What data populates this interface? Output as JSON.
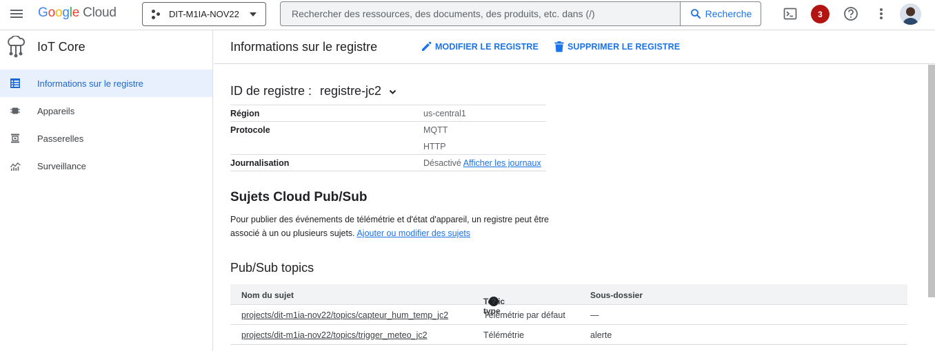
{
  "topbar": {
    "logo_google": "Google",
    "logo_cloud": "Cloud",
    "project_name": "DIT-M1IA-NOV22",
    "search_placeholder": "Rechercher des ressources, des documents, des produits, etc. dans (/)",
    "search_button": "Recherche",
    "notification_count": "3",
    "icons": [
      "menu-icon",
      "project-icon",
      "search-icon",
      "cloud-shell-icon",
      "help-icon",
      "more-vert-icon"
    ]
  },
  "sidebar": {
    "title": "IoT Core",
    "items": [
      {
        "label": "Informations sur le registre",
        "icon": "registry-icon",
        "active": true
      },
      {
        "label": "Appareils",
        "icon": "device-icon",
        "active": false
      },
      {
        "label": "Passerelles",
        "icon": "gateway-icon",
        "active": false
      },
      {
        "label": "Surveillance",
        "icon": "monitoring-icon",
        "active": false
      }
    ]
  },
  "main": {
    "title": "Informations sur le registre",
    "edit_action": "MODIFIER LE REGISTRE",
    "delete_action": "SUPPRIMER LE REGISTRE",
    "registry_id_label": "ID de registre :",
    "registry_id_value": "registre-jc2",
    "details": {
      "region_label": "Région",
      "region_value": "us-central1",
      "protocol_label": "Protocole",
      "protocol_values": [
        "MQTT",
        "HTTP"
      ],
      "logging_label": "Journalisation",
      "logging_value": "Désactivé",
      "logging_link": "Afficher les journaux"
    },
    "pubsub_title": "Sujets Cloud Pub/Sub",
    "pubsub_text_1": "Pour publier des événements de télémétrie et d'état d'appareil, un registre peut être",
    "pubsub_text_2": "associé à un ou plusieurs sujets.",
    "pubsub_link": "Ajouter ou modifier des sujets",
    "topics_title": "Pub/Sub topics",
    "table": {
      "columns": [
        "Nom du sujet",
        "Topic type",
        "Sous-dossier"
      ],
      "rows": [
        {
          "topic": "projects/dit-m1ia-nov22/topics/capteur_hum_temp_jc2",
          "type": "Télémétrie par défaut",
          "subfolder": "—"
        },
        {
          "topic": "projects/dit-m1ia-nov22/topics/trigger_meteo_jc2",
          "type": "Télémétrie",
          "subfolder": "alerte"
        }
      ]
    }
  }
}
